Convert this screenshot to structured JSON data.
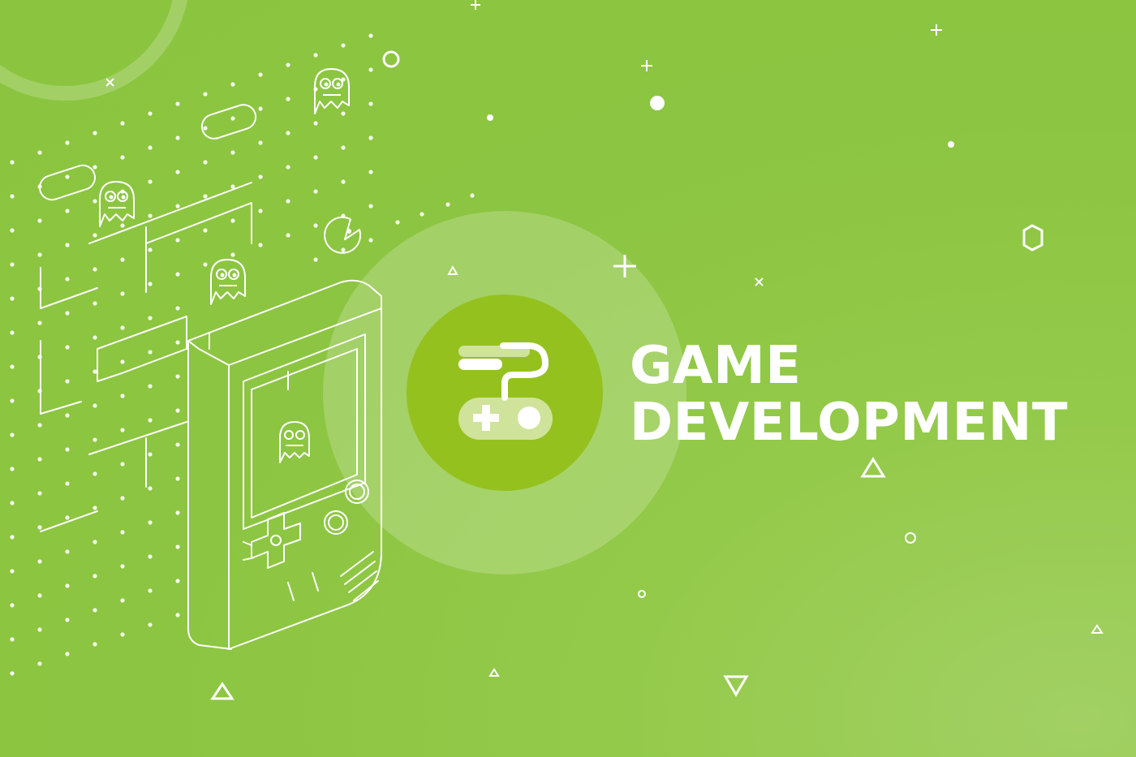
{
  "banner": {
    "title_line1": "GAME",
    "title_line2": "DEVELOPMENT"
  },
  "colors": {
    "background": "#8bc53f",
    "badge": "#95c11f",
    "text": "#ffffff"
  },
  "icons": [
    "gamepad-icon",
    "handheld-console-icon",
    "ghost-icon",
    "pacman-icon",
    "dpad-icon"
  ]
}
